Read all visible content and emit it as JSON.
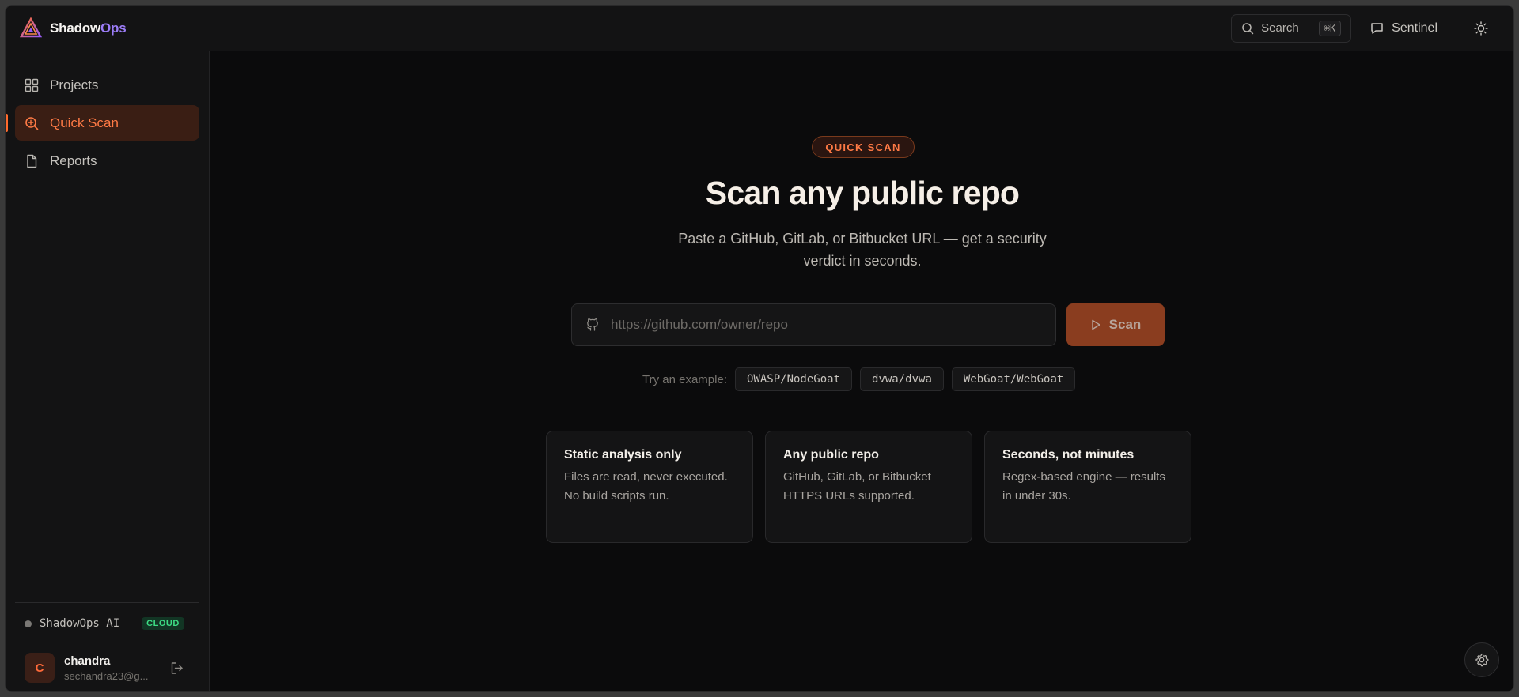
{
  "brand": {
    "name_part1": "Shadow",
    "name_part2": "Ops"
  },
  "header": {
    "search_label": "Search",
    "search_shortcut": "⌘K",
    "sentinel_label": "Sentinel"
  },
  "sidebar": {
    "items": [
      {
        "label": "Projects",
        "icon": "grid-icon",
        "active": false
      },
      {
        "label": "Quick Scan",
        "icon": "scan-search-icon",
        "active": true
      },
      {
        "label": "Reports",
        "icon": "file-icon",
        "active": false
      }
    ],
    "ai": {
      "name": "ShadowOps AI",
      "badge": "CLOUD"
    },
    "user": {
      "initial": "C",
      "name": "chandra",
      "email": "sechandra23@g..."
    }
  },
  "main": {
    "badge": "QUICK SCAN",
    "title": "Scan any public repo",
    "subtitle": "Paste a GitHub, GitLab, or Bitbucket URL — get a security verdict in seconds.",
    "url_placeholder": "https://github.com/owner/repo",
    "scan_label": "Scan",
    "examples_label": "Try an example:",
    "examples": [
      "OWASP/NodeGoat",
      "dvwa/dvwa",
      "WebGoat/WebGoat"
    ],
    "cards": [
      {
        "title": "Static analysis only",
        "text": "Files are read, never executed. No build scripts run."
      },
      {
        "title": "Any public repo",
        "text": "GitHub, GitLab, or Bitbucket HTTPS URLs supported."
      },
      {
        "title": "Seconds, not minutes",
        "text": "Regex-based engine — results in under 30s."
      }
    ]
  },
  "colors": {
    "accent": "#ff6a2c",
    "brand_ops": "#9b7cf6",
    "cloud_badge": "#3ddc84"
  }
}
